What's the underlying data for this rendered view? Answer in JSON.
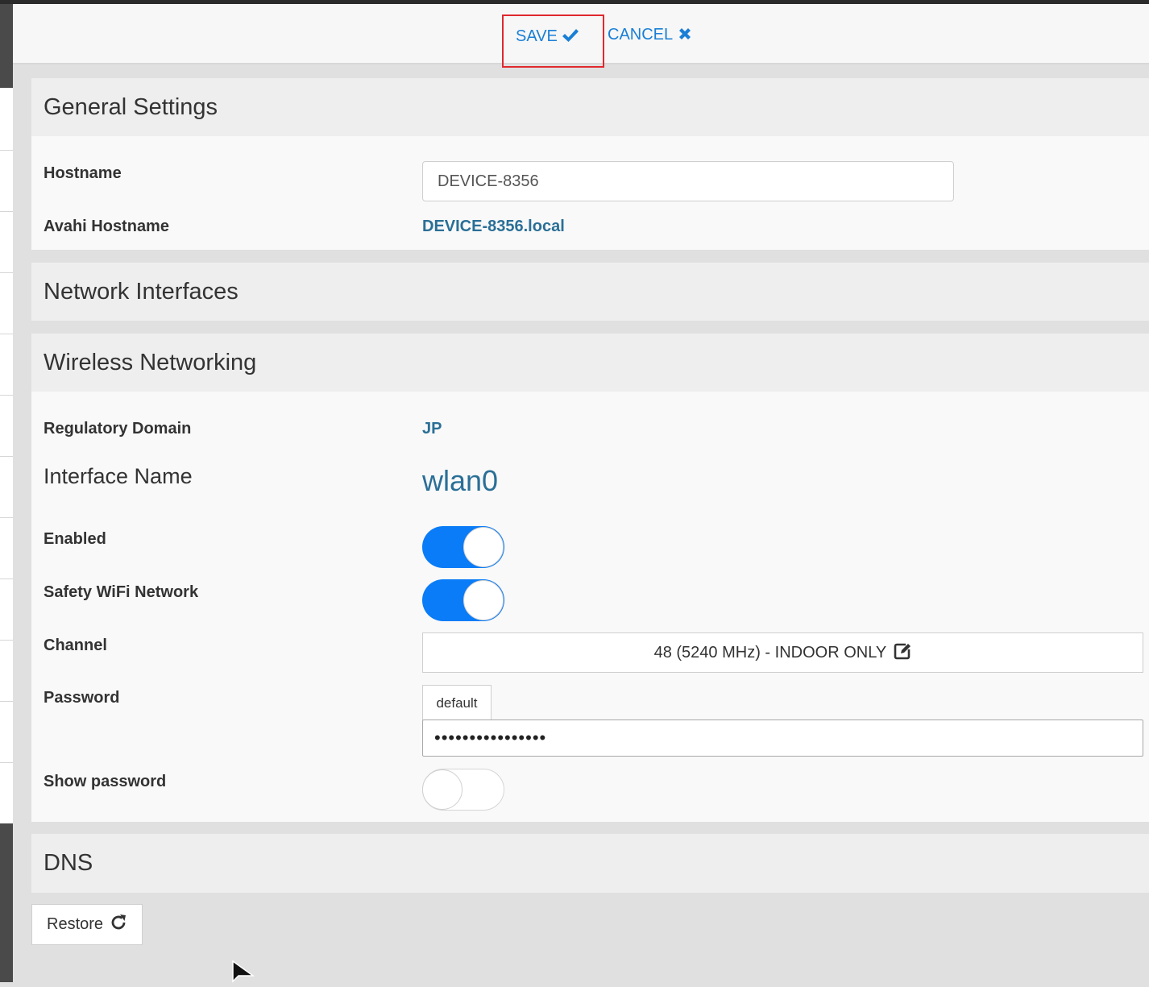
{
  "toolbar": {
    "save_label": "SAVE",
    "cancel_label": "CANCEL",
    "accent_color": "#1a7fd6",
    "save_icon": "check-icon",
    "cancel_icon": "x-icon"
  },
  "general": {
    "title": "General Settings",
    "hostname_label": "Hostname",
    "hostname_value": "DEVICE-8356",
    "avahi_label": "Avahi Hostname",
    "avahi_value": "DEVICE-8356.local"
  },
  "network": {
    "title": "Network Interfaces"
  },
  "wireless": {
    "title": "Wireless Networking",
    "regdomain_label": "Regulatory Domain",
    "regdomain_value": "JP",
    "iface_label": "Interface Name",
    "iface_value": "wlan0",
    "enabled_label": "Enabled",
    "enabled_on": true,
    "safety_label": "Safety WiFi Network",
    "safety_on": true,
    "channel_label": "Channel",
    "channel_value": "48 (5240 MHz) - INDOOR ONLY",
    "channel_icon": "edit-icon",
    "password_label": "Password",
    "password_default_label": "default",
    "password_value": "••••••••••••••••",
    "show_password_label": "Show password",
    "show_password_on": false,
    "toggle_on_color": "#0a7cf7"
  },
  "dns": {
    "title": "DNS"
  },
  "footer": {
    "restore_label": "Restore",
    "restore_icon": "refresh-icon"
  }
}
